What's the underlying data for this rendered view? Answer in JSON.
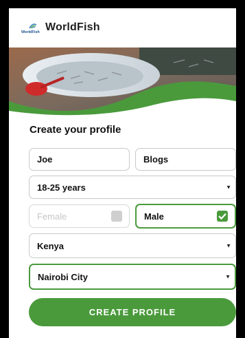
{
  "header": {
    "logo_text": "WorldFish",
    "brand": "WorldFish",
    "logo_icon": "worldfish-logo-icon"
  },
  "hero": {
    "image": "fish-in-basin-photo"
  },
  "form": {
    "title": "Create your profile",
    "first_name": "Joe",
    "last_name": "Blogs",
    "age_range": "18-25 years",
    "gender_female": {
      "label": "Female",
      "checked": false
    },
    "gender_male": {
      "label": "Male",
      "checked": true
    },
    "country": "Kenya",
    "city": "Nairobi City",
    "submit_label": "CREATE PROFILE"
  },
  "colors": {
    "accent": "#4a9a3c",
    "checkbox_off": "#cfcfcf"
  }
}
